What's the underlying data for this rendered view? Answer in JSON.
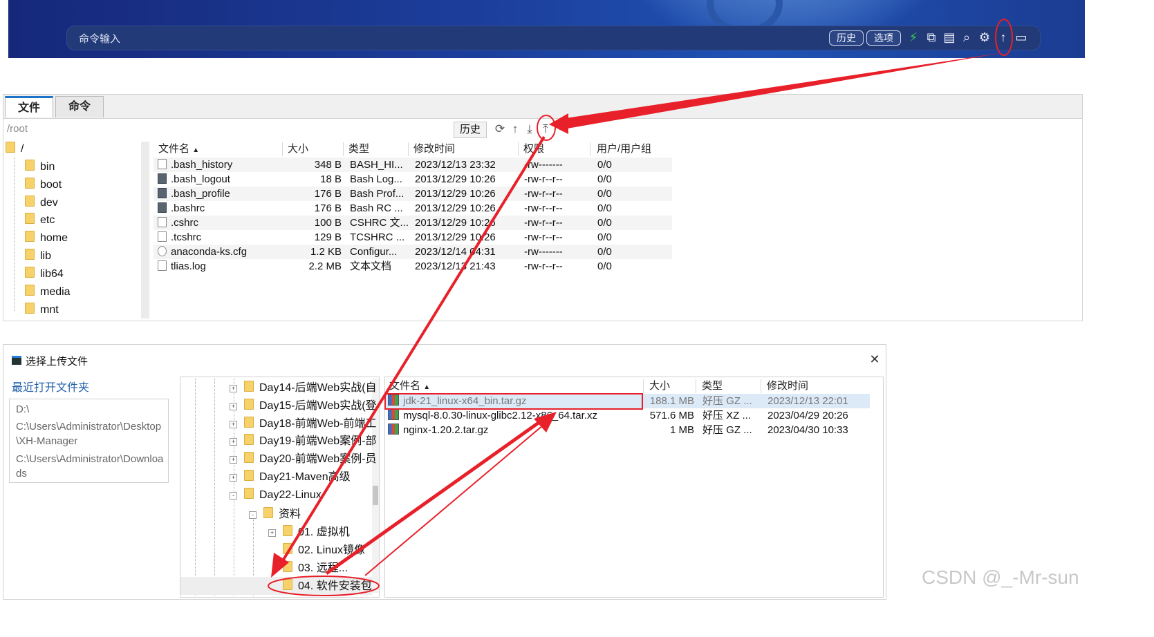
{
  "command_bar": {
    "input_label": "命令输入",
    "history_button": "历史",
    "options_button": "选项",
    "icons": [
      "lightning-icon",
      "copy-icon",
      "paste-icon",
      "search-icon",
      "gear-icon",
      "upload-arrow-icon",
      "window-icon"
    ]
  },
  "file_panel": {
    "tabs": [
      "文件",
      "命令"
    ],
    "path": "/root",
    "history_button": "历史",
    "tree": [
      "/",
      "bin",
      "boot",
      "dev",
      "etc",
      "home",
      "lib",
      "lib64",
      "media",
      "mnt"
    ],
    "columns": [
      "文件名",
      "大小",
      "类型",
      "修改时间",
      "权限",
      "用户/用户组"
    ],
    "files": [
      {
        "name": ".bash_history",
        "size": "348 B",
        "type": "BASH_HI...",
        "modified": "2023/12/13 23:32",
        "perm": "-rw-------",
        "owner": "0/0"
      },
      {
        "name": ".bash_logout",
        "size": "18 B",
        "type": "Bash Log...",
        "modified": "2013/12/29 10:26",
        "perm": "-rw-r--r--",
        "owner": "0/0"
      },
      {
        "name": ".bash_profile",
        "size": "176 B",
        "type": "Bash Prof...",
        "modified": "2013/12/29 10:26",
        "perm": "-rw-r--r--",
        "owner": "0/0"
      },
      {
        "name": ".bashrc",
        "size": "176 B",
        "type": "Bash RC ...",
        "modified": "2013/12/29 10:26",
        "perm": "-rw-r--r--",
        "owner": "0/0"
      },
      {
        "name": ".cshrc",
        "size": "100 B",
        "type": "CSHRC 文...",
        "modified": "2013/12/29 10:26",
        "perm": "-rw-r--r--",
        "owner": "0/0"
      },
      {
        "name": ".tcshrc",
        "size": "129 B",
        "type": "TCSHRC ...",
        "modified": "2013/12/29 10:26",
        "perm": "-rw-r--r--",
        "owner": "0/0"
      },
      {
        "name": "anaconda-ks.cfg",
        "size": "1.2 KB",
        "type": "Configur...",
        "modified": "2023/12/14 04:31",
        "perm": "-rw-------",
        "owner": "0/0"
      },
      {
        "name": "tlias.log",
        "size": "2.2 MB",
        "type": "文本文档",
        "modified": "2023/12/13 21:43",
        "perm": "-rw-r--r--",
        "owner": "0/0"
      }
    ]
  },
  "upload_dialog": {
    "title": "选择上传文件",
    "close_glyph": "✕",
    "recent_label": "最近打开文件夹",
    "recent_folders": [
      "D:\\",
      "C:\\Users\\Administrator\\Desktop\\XH-Manager",
      "C:\\Users\\Administrator\\Downloads"
    ],
    "tree": [
      {
        "label": "Day14-后端Web实战(自",
        "toggle": "+"
      },
      {
        "label": "Day15-后端Web实战(登",
        "toggle": "+"
      },
      {
        "label": "Day18-前端Web-前端工",
        "toggle": "+"
      },
      {
        "label": "Day19-前端Web案例-部",
        "toggle": "+"
      },
      {
        "label": "Day20-前端Web案例-员",
        "toggle": "+"
      },
      {
        "label": "Day21-Maven高级",
        "toggle": "+"
      },
      {
        "label": "Day22-Linux",
        "toggle": "-"
      },
      {
        "label": "资料",
        "toggle": "-"
      },
      {
        "label": "01. 虚拟机",
        "toggle": "+"
      },
      {
        "label": "02. Linux镜像",
        "toggle": ""
      },
      {
        "label": "03. 远程...",
        "toggle": ""
      },
      {
        "label": "04. 软件安装包",
        "toggle": ""
      }
    ],
    "columns": [
      "文件名",
      "大小",
      "类型",
      "修改时间"
    ],
    "files": [
      {
        "name": "jdk-21_linux-x64_bin.tar.gz",
        "size": "188.1 MB",
        "type": "好压 GZ ...",
        "modified": "2023/12/13 22:01"
      },
      {
        "name": "mysql-8.0.30-linux-glibc2.12-x86_64.tar.xz",
        "size": "571.6 MB",
        "type": "好压 XZ ...",
        "modified": "2023/04/29 20:26"
      },
      {
        "name": "nginx-1.20.2.tar.gz",
        "size": "1 MB",
        "type": "好压 GZ ...",
        "modified": "2023/04/30 10:33"
      }
    ]
  },
  "watermark": "CSDN @_-Mr-sun",
  "colors": {
    "banner": "#1c3f9c",
    "annotation": "#e8202a",
    "selected_row": "#dce9f7",
    "tab_accent": "#1d73c8"
  }
}
